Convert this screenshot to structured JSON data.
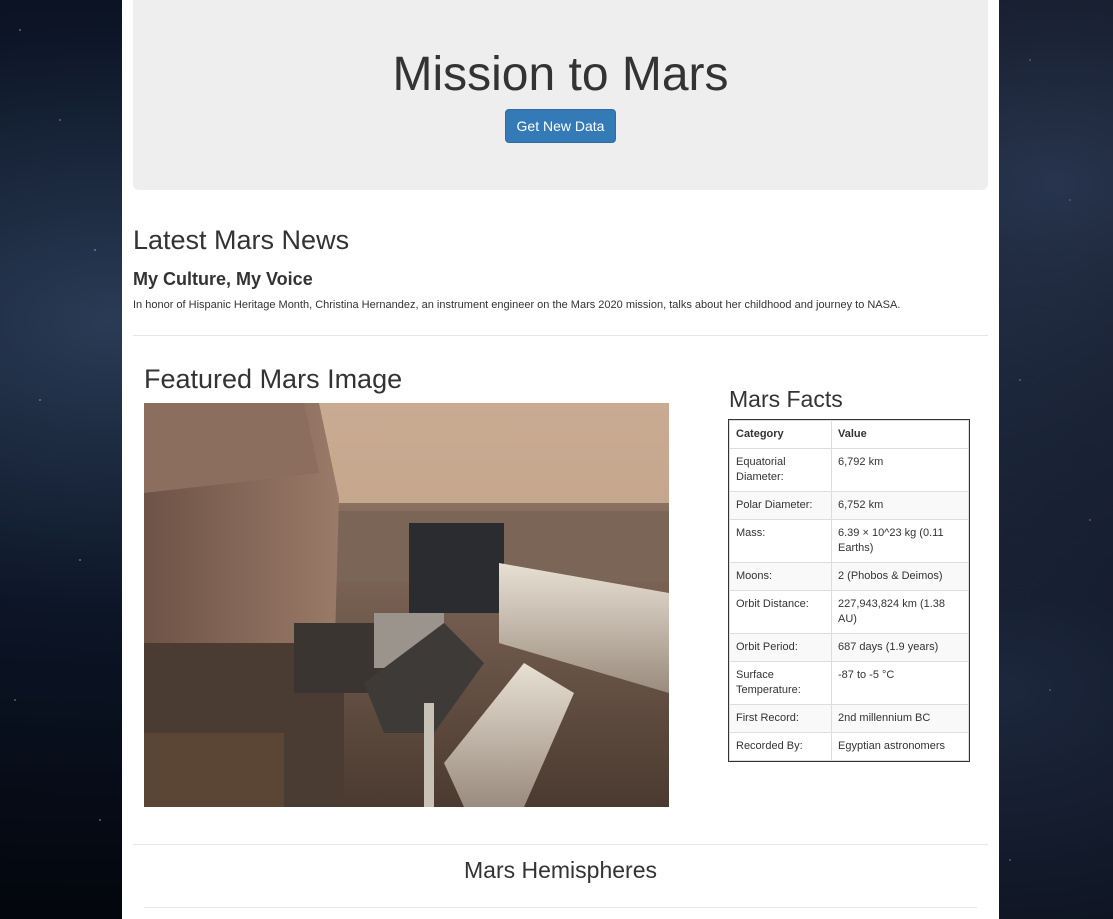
{
  "jumbotron": {
    "title": "Mission to Mars",
    "button_label": "Get New Data"
  },
  "news": {
    "section_title": "Latest Mars News",
    "title": "My Culture, My Voice",
    "paragraph": "In honor of Hispanic Heritage Month, Christina Hernandez, an instrument engineer on the Mars 2020 mission, talks about her childhood and journey to NASA."
  },
  "featured": {
    "section_title": "Featured Mars Image"
  },
  "facts": {
    "section_title": "Mars Facts",
    "headers": [
      "Category",
      "Value"
    ],
    "rows": [
      {
        "category": "Equatorial Diameter:",
        "value": "6,792 km"
      },
      {
        "category": "Polar Diameter:",
        "value": "6,752 km"
      },
      {
        "category": "Mass:",
        "value": "6.39 × 10^23 kg (0.11 Earths)"
      },
      {
        "category": "Moons:",
        "value": "2 (Phobos & Deimos)"
      },
      {
        "category": "Orbit Distance:",
        "value": "227,943,824 km (1.38 AU)"
      },
      {
        "category": "Orbit Period:",
        "value": "687 days (1.9 years)"
      },
      {
        "category": "Surface Temperature:",
        "value": "-87 to -5 °C"
      },
      {
        "category": "First Record:",
        "value": "2nd millennium BC"
      },
      {
        "category": "Recorded By:",
        "value": "Egyptian astronomers"
      }
    ]
  },
  "hemispheres": {
    "section_title": "Mars Hemispheres"
  }
}
